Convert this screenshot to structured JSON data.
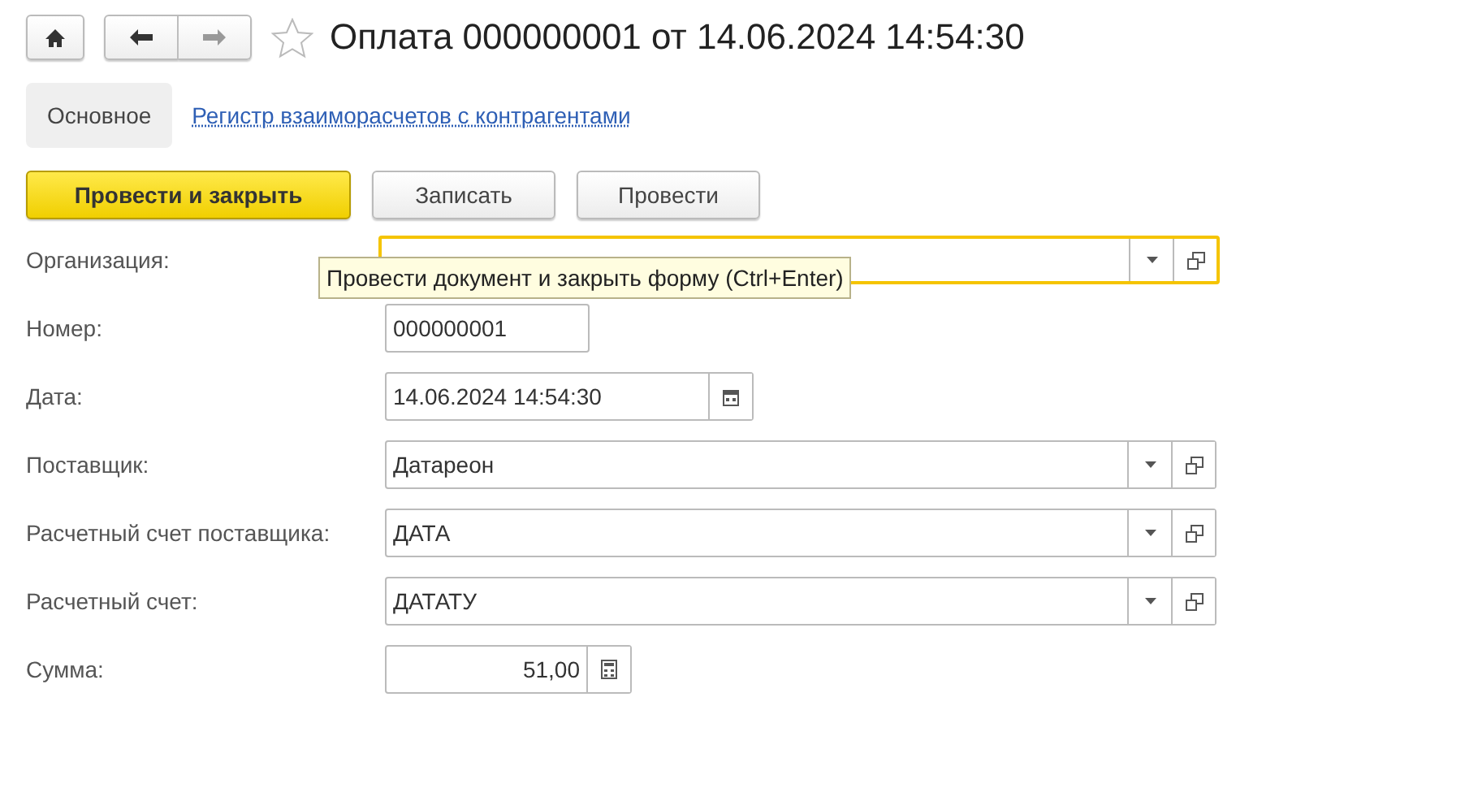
{
  "window": {
    "title": "Оплата 000000001 от 14.06.2024 14:54:30",
    "favorite": false
  },
  "tabs": [
    {
      "label": "Основное",
      "selected": true
    },
    {
      "label": "Регистр взаиморасчетов с контрагентами",
      "selected": false
    }
  ],
  "toolbar": [
    {
      "label": "Провести и закрыть",
      "kind": "primary"
    },
    {
      "label": "Записать",
      "kind": "normal"
    },
    {
      "label": "Провести",
      "kind": "normal"
    }
  ],
  "tooltip": "Провести документ и закрыть форму (Ctrl+Enter)",
  "fields": [
    {
      "label": "Организация:",
      "kind": "select",
      "focused": true
    },
    {
      "label": "Номер:",
      "kind": "text",
      "value": "000000001",
      "focused": false
    },
    {
      "label": "Дата:",
      "kind": "date",
      "value": "14.06.2024 14:54:30",
      "focused": false
    },
    {
      "label": "Поставщик:",
      "kind": "select",
      "value": "Датареон",
      "focused": false
    },
    {
      "label": "Расчетный счет поставщика:",
      "kind": "select",
      "value": "ДАТА",
      "focused": false
    },
    {
      "label": "Расчетный счет:",
      "kind": "select",
      "value": "ДАТАТУ",
      "focused": false
    },
    {
      "label": "Сумма:",
      "kind": "number",
      "value": "51,00",
      "focused": false
    }
  ]
}
